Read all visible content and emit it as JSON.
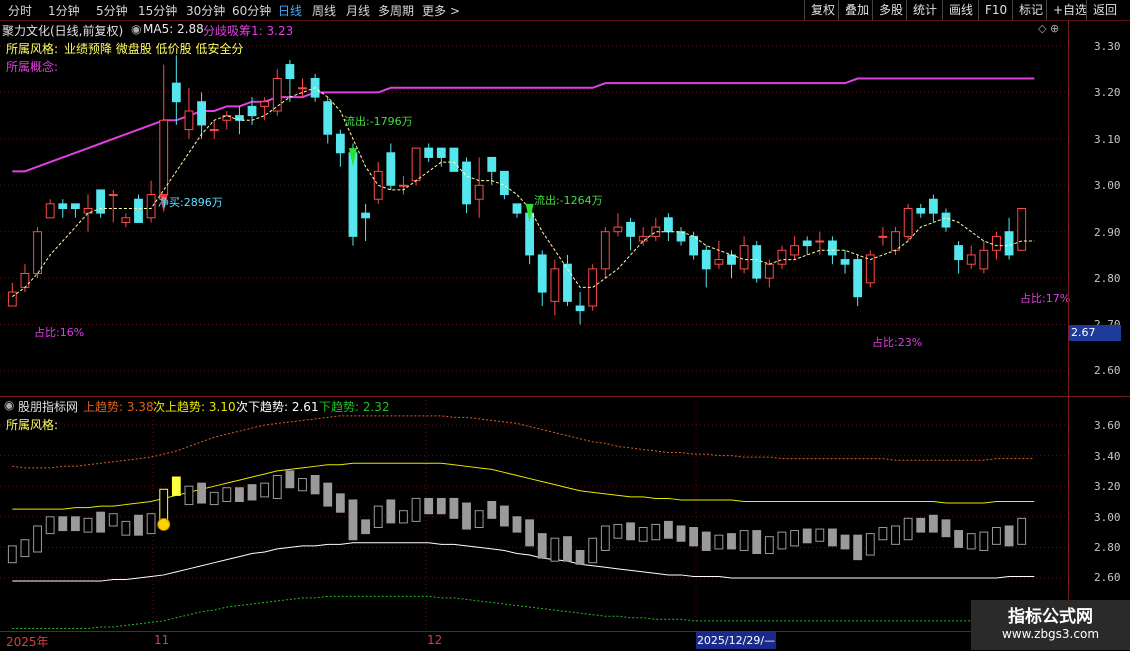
{
  "toolbar": {
    "periods": [
      "分时",
      "1分钟",
      "5分钟",
      "15分钟",
      "30分钟",
      "60分钟",
      "日线",
      "周线",
      "月线",
      "多周期",
      "更多"
    ],
    "active": "日线",
    "more_arrow": ">",
    "right_buttons": [
      "复权",
      "叠加",
      "多股",
      "统计",
      "画线",
      "F10",
      "标记",
      "+自选",
      "返回"
    ]
  },
  "main_panel": {
    "title": "聚力文化(日线,前复权)",
    "ma_label": "MA5: 2.88",
    "fenqi_label": "分歧吸筹1: 3.23",
    "style_label": "所属风格:",
    "style_tags": "业绩预降 微盘股 低价股 低安全分",
    "concept_label": "所属概念:",
    "y_ticks": [
      "3.30",
      "3.20",
      "3.10",
      "3.00",
      "2.90",
      "2.80",
      "2.70",
      "2.60"
    ],
    "price_tag": "2.67",
    "annotations": {
      "net_buy": "净买:2896万",
      "outflow1": "流出:-1796万",
      "outflow2": "流出:-1264万",
      "ratio1": "占比:16%",
      "ratio2": "占比:23%",
      "ratio3": "占比:17%"
    },
    "colors": {
      "up": "#ff4a4a",
      "down": "#55e6ee",
      "ma": "#ffffaa",
      "fenqi": "#e040e0"
    }
  },
  "sub_panel": {
    "title": "股朋指标网",
    "up_trend": "上趋势: 3.38",
    "second_up": "次上趋势: 3.10",
    "second_down": "次下趋势: 2.61",
    "down_trend": "下趋势: 2.32",
    "style_label": "所属风格:",
    "y_ticks": [
      "3.60",
      "3.40",
      "3.20",
      "3.00",
      "2.80",
      "2.60"
    ],
    "colors": {
      "up_trend": "#e06020",
      "second_up": "#e8e800",
      "second_down": "#ffffff",
      "down_trend": "#20c020"
    }
  },
  "date_axis": {
    "labels": [
      "2025年",
      "11",
      "12"
    ],
    "cursor": "2025/12/29/—"
  },
  "watermark": {
    "line1": "指标公式网",
    "line2": "www.zbgs3.com"
  },
  "chart_data": {
    "type": "candlestick",
    "title": "聚力文化(日线,前复权)",
    "ylim": [
      2.55,
      3.35
    ],
    "candles": [
      {
        "o": 2.74,
        "c": 2.77,
        "h": 2.79,
        "l": 2.74
      },
      {
        "o": 2.78,
        "c": 2.81,
        "h": 2.83,
        "l": 2.77
      },
      {
        "o": 2.81,
        "c": 2.9,
        "h": 2.91,
        "l": 2.8
      },
      {
        "o": 2.93,
        "c": 2.96,
        "h": 2.97,
        "l": 2.93
      },
      {
        "o": 2.96,
        "c": 2.95,
        "h": 2.97,
        "l": 2.93
      },
      {
        "o": 2.96,
        "c": 2.95,
        "h": 2.96,
        "l": 2.93
      },
      {
        "o": 2.94,
        "c": 2.95,
        "h": 2.98,
        "l": 2.9
      },
      {
        "o": 2.99,
        "c": 2.94,
        "h": 2.99,
        "l": 2.93
      },
      {
        "o": 2.98,
        "c": 2.98,
        "h": 2.99,
        "l": 2.92
      },
      {
        "o": 2.92,
        "c": 2.93,
        "h": 2.94,
        "l": 2.91
      },
      {
        "o": 2.97,
        "c": 2.92,
        "h": 2.98,
        "l": 2.92
      },
      {
        "o": 2.93,
        "c": 2.98,
        "h": 3.01,
        "l": 2.92
      },
      {
        "o": 2.98,
        "c": 3.14,
        "h": 3.26,
        "l": 2.97
      },
      {
        "o": 3.22,
        "c": 3.18,
        "h": 3.28,
        "l": 3.13
      },
      {
        "o": 3.12,
        "c": 3.16,
        "h": 3.21,
        "l": 3.1
      },
      {
        "o": 3.18,
        "c": 3.13,
        "h": 3.2,
        "l": 3.1
      },
      {
        "o": 3.12,
        "c": 3.12,
        "h": 3.14,
        "l": 3.1
      },
      {
        "o": 3.14,
        "c": 3.15,
        "h": 3.16,
        "l": 3.12
      },
      {
        "o": 3.15,
        "c": 3.14,
        "h": 3.17,
        "l": 3.11
      },
      {
        "o": 3.17,
        "c": 3.15,
        "h": 3.19,
        "l": 3.13
      },
      {
        "o": 3.17,
        "c": 3.18,
        "h": 3.19,
        "l": 3.14
      },
      {
        "o": 3.16,
        "c": 3.23,
        "h": 3.25,
        "l": 3.15
      },
      {
        "o": 3.26,
        "c": 3.23,
        "h": 3.27,
        "l": 3.18
      },
      {
        "o": 3.21,
        "c": 3.21,
        "h": 3.23,
        "l": 3.19
      },
      {
        "o": 3.23,
        "c": 3.19,
        "h": 3.24,
        "l": 3.18
      },
      {
        "o": 3.18,
        "c": 3.11,
        "h": 3.19,
        "l": 3.09
      },
      {
        "o": 3.11,
        "c": 3.07,
        "h": 3.12,
        "l": 3.04
      },
      {
        "o": 3.07,
        "c": 2.89,
        "h": 3.09,
        "l": 2.87
      },
      {
        "o": 2.94,
        "c": 2.93,
        "h": 2.96,
        "l": 2.88
      },
      {
        "o": 2.97,
        "c": 3.03,
        "h": 3.05,
        "l": 2.96
      },
      {
        "o": 3.07,
        "c": 3.0,
        "h": 3.09,
        "l": 2.99
      },
      {
        "o": 3.0,
        "c": 3.0,
        "h": 3.02,
        "l": 2.98
      },
      {
        "o": 3.01,
        "c": 3.08,
        "h": 3.08,
        "l": 3.0
      },
      {
        "o": 3.08,
        "c": 3.06,
        "h": 3.09,
        "l": 3.05
      },
      {
        "o": 3.08,
        "c": 3.06,
        "h": 3.08,
        "l": 3.04
      },
      {
        "o": 3.08,
        "c": 3.03,
        "h": 3.08,
        "l": 3.03
      },
      {
        "o": 3.05,
        "c": 2.96,
        "h": 3.06,
        "l": 2.94
      },
      {
        "o": 2.97,
        "c": 3.0,
        "h": 3.06,
        "l": 2.93
      },
      {
        "o": 3.06,
        "c": 3.03,
        "h": 3.06,
        "l": 3.0
      },
      {
        "o": 3.03,
        "c": 2.98,
        "h": 3.03,
        "l": 2.97
      },
      {
        "o": 2.96,
        "c": 2.94,
        "h": 2.96,
        "l": 2.93
      },
      {
        "o": 2.94,
        "c": 2.85,
        "h": 2.95,
        "l": 2.83
      },
      {
        "o": 2.85,
        "c": 2.77,
        "h": 2.86,
        "l": 2.74
      },
      {
        "o": 2.75,
        "c": 2.82,
        "h": 2.84,
        "l": 2.72
      },
      {
        "o": 2.83,
        "c": 2.75,
        "h": 2.85,
        "l": 2.74
      },
      {
        "o": 2.74,
        "c": 2.73,
        "h": 2.77,
        "l": 2.7
      },
      {
        "o": 2.74,
        "c": 2.82,
        "h": 2.83,
        "l": 2.73
      },
      {
        "o": 2.82,
        "c": 2.9,
        "h": 2.91,
        "l": 2.8
      },
      {
        "o": 2.9,
        "c": 2.91,
        "h": 2.94,
        "l": 2.89
      },
      {
        "o": 2.92,
        "c": 2.89,
        "h": 2.93,
        "l": 2.86
      },
      {
        "o": 2.88,
        "c": 2.89,
        "h": 2.91,
        "l": 2.87
      },
      {
        "o": 2.89,
        "c": 2.91,
        "h": 2.93,
        "l": 2.88
      },
      {
        "o": 2.93,
        "c": 2.9,
        "h": 2.94,
        "l": 2.88
      },
      {
        "o": 2.9,
        "c": 2.88,
        "h": 2.91,
        "l": 2.87
      },
      {
        "o": 2.89,
        "c": 2.85,
        "h": 2.9,
        "l": 2.84
      },
      {
        "o": 2.86,
        "c": 2.82,
        "h": 2.87,
        "l": 2.78
      },
      {
        "o": 2.83,
        "c": 2.84,
        "h": 2.88,
        "l": 2.82
      },
      {
        "o": 2.85,
        "c": 2.83,
        "h": 2.86,
        "l": 2.8
      },
      {
        "o": 2.82,
        "c": 2.87,
        "h": 2.89,
        "l": 2.81
      },
      {
        "o": 2.87,
        "c": 2.8,
        "h": 2.88,
        "l": 2.79
      },
      {
        "o": 2.8,
        "c": 2.83,
        "h": 2.84,
        "l": 2.78
      },
      {
        "o": 2.83,
        "c": 2.86,
        "h": 2.87,
        "l": 2.82
      },
      {
        "o": 2.85,
        "c": 2.87,
        "h": 2.89,
        "l": 2.84
      },
      {
        "o": 2.88,
        "c": 2.87,
        "h": 2.89,
        "l": 2.85
      },
      {
        "o": 2.88,
        "c": 2.88,
        "h": 2.9,
        "l": 2.85
      },
      {
        "o": 2.88,
        "c": 2.85,
        "h": 2.89,
        "l": 2.83
      },
      {
        "o": 2.84,
        "c": 2.83,
        "h": 2.86,
        "l": 2.81
      },
      {
        "o": 2.84,
        "c": 2.76,
        "h": 2.85,
        "l": 2.74
      },
      {
        "o": 2.79,
        "c": 2.85,
        "h": 2.86,
        "l": 2.78
      },
      {
        "o": 2.89,
        "c": 2.89,
        "h": 2.91,
        "l": 2.87
      },
      {
        "o": 2.86,
        "c": 2.9,
        "h": 2.91,
        "l": 2.85
      },
      {
        "o": 2.89,
        "c": 2.95,
        "h": 2.96,
        "l": 2.88
      },
      {
        "o": 2.95,
        "c": 2.94,
        "h": 2.96,
        "l": 2.93
      },
      {
        "o": 2.97,
        "c": 2.94,
        "h": 2.98,
        "l": 2.92
      },
      {
        "o": 2.94,
        "c": 2.91,
        "h": 2.95,
        "l": 2.9
      },
      {
        "o": 2.87,
        "c": 2.84,
        "h": 2.88,
        "l": 2.81
      },
      {
        "o": 2.83,
        "c": 2.85,
        "h": 2.87,
        "l": 2.82
      },
      {
        "o": 2.82,
        "c": 2.86,
        "h": 2.88,
        "l": 2.81
      },
      {
        "o": 2.86,
        "c": 2.89,
        "h": 2.9,
        "l": 2.84
      },
      {
        "o": 2.9,
        "c": 2.85,
        "h": 2.93,
        "l": 2.84
      },
      {
        "o": 2.86,
        "c": 2.95,
        "h": 2.95,
        "l": 2.86
      }
    ],
    "series": [
      {
        "name": "MA5",
        "values": [
          2.76,
          2.78,
          2.81,
          2.85,
          2.88,
          2.91,
          2.94,
          2.95,
          2.95,
          2.95,
          2.95,
          2.95,
          2.99,
          3.03,
          3.07,
          3.11,
          3.14,
          3.15,
          3.14,
          3.14,
          3.15,
          3.17,
          3.19,
          3.2,
          3.21,
          3.19,
          3.16,
          3.1,
          3.04,
          3.0,
          2.99,
          2.99,
          3.01,
          3.03,
          3.05,
          3.05,
          3.02,
          3.01,
          3.01,
          3.0,
          2.98,
          2.95,
          2.9,
          2.86,
          2.82,
          2.78,
          2.78,
          2.8,
          2.82,
          2.85,
          2.88,
          2.9,
          2.9,
          2.9,
          2.89,
          2.87,
          2.86,
          2.85,
          2.84,
          2.84,
          2.83,
          2.84,
          2.84,
          2.85,
          2.86,
          2.86,
          2.86,
          2.85,
          2.84,
          2.85,
          2.86,
          2.88,
          2.91,
          2.92,
          2.93,
          2.92,
          2.9,
          2.88,
          2.87,
          2.87,
          2.88,
          2.88
        ]
      },
      {
        "name": "分歧吸筹1",
        "values": [
          3.03,
          3.03,
          3.04,
          3.05,
          3.06,
          3.07,
          3.08,
          3.09,
          3.1,
          3.11,
          3.12,
          3.13,
          3.14,
          3.14,
          3.15,
          3.16,
          3.16,
          3.17,
          3.17,
          3.18,
          3.18,
          3.19,
          3.19,
          3.19,
          3.2,
          3.2,
          3.2,
          3.2,
          3.2,
          3.2,
          3.21,
          3.21,
          3.21,
          3.21,
          3.21,
          3.21,
          3.21,
          3.21,
          3.21,
          3.21,
          3.21,
          3.21,
          3.21,
          3.21,
          3.21,
          3.21,
          3.21,
          3.22,
          3.22,
          3.22,
          3.22,
          3.22,
          3.22,
          3.22,
          3.22,
          3.22,
          3.22,
          3.22,
          3.22,
          3.22,
          3.22,
          3.22,
          3.22,
          3.22,
          3.22,
          3.22,
          3.22,
          3.23,
          3.23,
          3.23,
          3.23,
          3.23,
          3.23,
          3.23,
          3.23,
          3.23,
          3.23,
          3.23,
          3.23,
          3.23,
          3.23,
          3.23
        ]
      }
    ],
    "sub_chart": {
      "ylim": [
        2.5,
        3.75
      ],
      "series": [
        {
          "name": "上趋势",
          "values": [
            3.33,
            3.32,
            3.32,
            3.32,
            3.33,
            3.33,
            3.34,
            3.35,
            3.36,
            3.37,
            3.38,
            3.39,
            3.41,
            3.43,
            3.46,
            3.49,
            3.52,
            3.54,
            3.56,
            3.58,
            3.6,
            3.61,
            3.62,
            3.63,
            3.64,
            3.65,
            3.66,
            3.66,
            3.66,
            3.66,
            3.66,
            3.66,
            3.66,
            3.66,
            3.66,
            3.65,
            3.65,
            3.64,
            3.63,
            3.62,
            3.61,
            3.59,
            3.57,
            3.55,
            3.53,
            3.51,
            3.49,
            3.48,
            3.46,
            3.45,
            3.44,
            3.43,
            3.42,
            3.42,
            3.41,
            3.41,
            3.4,
            3.4,
            3.39,
            3.39,
            3.39,
            3.38,
            3.38,
            3.38,
            3.38,
            3.38,
            3.38,
            3.38,
            3.38,
            3.38,
            3.37,
            3.37,
            3.37,
            3.37,
            3.37,
            3.37,
            3.37,
            3.37,
            3.38,
            3.38,
            3.38,
            3.38
          ]
        },
        {
          "name": "次上趋势",
          "values": [
            3.05,
            3.05,
            3.05,
            3.05,
            3.05,
            3.06,
            3.06,
            3.07,
            3.07,
            3.08,
            3.09,
            3.1,
            3.12,
            3.14,
            3.16,
            3.18,
            3.2,
            3.22,
            3.24,
            3.26,
            3.28,
            3.3,
            3.31,
            3.32,
            3.33,
            3.34,
            3.34,
            3.35,
            3.35,
            3.35,
            3.35,
            3.35,
            3.35,
            3.35,
            3.35,
            3.34,
            3.33,
            3.32,
            3.31,
            3.29,
            3.27,
            3.25,
            3.23,
            3.21,
            3.19,
            3.17,
            3.16,
            3.15,
            3.14,
            3.13,
            3.13,
            3.12,
            3.12,
            3.11,
            3.11,
            3.11,
            3.11,
            3.11,
            3.1,
            3.1,
            3.1,
            3.1,
            3.1,
            3.1,
            3.1,
            3.1,
            3.1,
            3.1,
            3.1,
            3.1,
            3.1,
            3.1,
            3.1,
            3.1,
            3.09,
            3.09,
            3.09,
            3.09,
            3.1,
            3.1,
            3.1,
            3.1
          ]
        },
        {
          "name": "次下趋势",
          "values": [
            2.58,
            2.58,
            2.58,
            2.58,
            2.58,
            2.58,
            2.58,
            2.58,
            2.59,
            2.59,
            2.6,
            2.61,
            2.62,
            2.64,
            2.66,
            2.68,
            2.7,
            2.72,
            2.74,
            2.76,
            2.77,
            2.79,
            2.8,
            2.81,
            2.81,
            2.82,
            2.82,
            2.83,
            2.83,
            2.83,
            2.83,
            2.83,
            2.83,
            2.83,
            2.82,
            2.82,
            2.81,
            2.8,
            2.79,
            2.78,
            2.76,
            2.75,
            2.73,
            2.72,
            2.71,
            2.69,
            2.68,
            2.67,
            2.66,
            2.65,
            2.64,
            2.63,
            2.62,
            2.62,
            2.61,
            2.61,
            2.61,
            2.6,
            2.6,
            2.6,
            2.6,
            2.6,
            2.6,
            2.6,
            2.6,
            2.6,
            2.6,
            2.6,
            2.6,
            2.6,
            2.6,
            2.6,
            2.6,
            2.6,
            2.6,
            2.6,
            2.6,
            2.6,
            2.6,
            2.61,
            2.61,
            2.61
          ]
        },
        {
          "name": "下趋势",
          "values": [
            2.27,
            2.27,
            2.27,
            2.27,
            2.27,
            2.27,
            2.27,
            2.28,
            2.28,
            2.29,
            2.3,
            2.31,
            2.32,
            2.34,
            2.36,
            2.38,
            2.39,
            2.41,
            2.42,
            2.43,
            2.44,
            2.45,
            2.46,
            2.47,
            2.47,
            2.48,
            2.48,
            2.48,
            2.48,
            2.48,
            2.48,
            2.48,
            2.48,
            2.48,
            2.47,
            2.47,
            2.46,
            2.45,
            2.44,
            2.43,
            2.42,
            2.41,
            2.4,
            2.39,
            2.38,
            2.37,
            2.36,
            2.35,
            2.35,
            2.34,
            2.34,
            2.33,
            2.33,
            2.33,
            2.32,
            2.32,
            2.32,
            2.32,
            2.32,
            2.32,
            2.32,
            2.32,
            2.32,
            2.32,
            2.32,
            2.32,
            2.32,
            2.32,
            2.32,
            2.32,
            2.32,
            2.32,
            2.32,
            2.32,
            2.32,
            2.32,
            2.32,
            2.32,
            2.32,
            2.32,
            2.32,
            2.32
          ]
        }
      ]
    }
  }
}
